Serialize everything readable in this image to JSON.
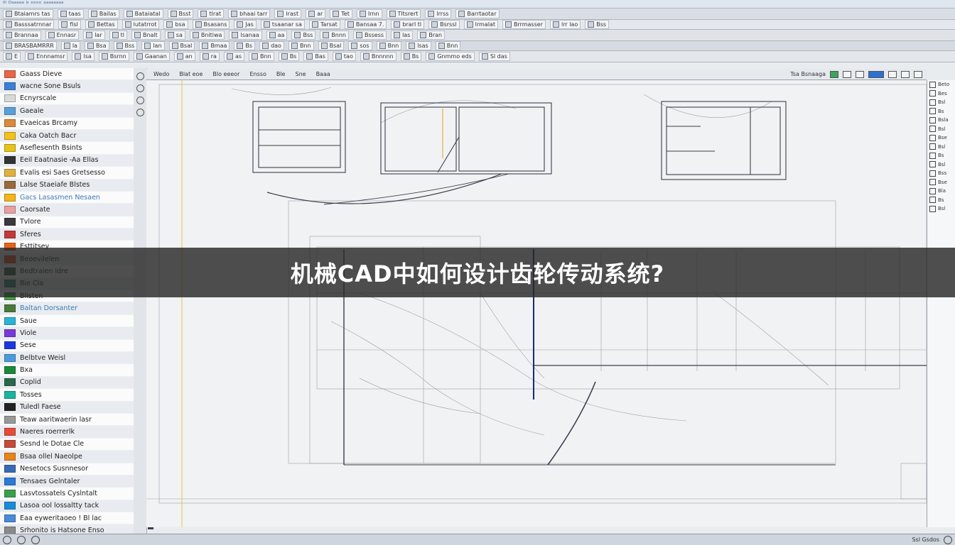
{
  "titlebar": {
    "text": "ᴵᴵᴵ ᴰᵃᵃᵃᵃᵃ ᵇ ᵉᵉᵉᵉ ᵃᵃᵃᵃᵃᵃᵃᵃ"
  },
  "toolbar_rows": [
    {
      "items": [
        "Btaiamrs tas",
        "taas",
        "Bailas",
        "Bataiatal",
        "Bsst",
        "tlrat",
        "bhaai tarr",
        "lrast",
        "ar",
        "Tet",
        "Irnn",
        "Tltsrert",
        "lrrss",
        "Barrtaotar"
      ]
    },
    {
      "items": [
        "Basssatrnnar",
        "fisl",
        "Bettas",
        "lutatrrot",
        "bsa",
        "Bsasans",
        "Jas",
        "tsaanar sa",
        "Tarsat",
        "Bansaa 7.",
        "brarl tl",
        "Bsrssl",
        "lrmalat",
        "Brrmasser",
        "lrr lao",
        "Bss"
      ]
    },
    {
      "items": [
        "Brannaa",
        "Ennasr",
        "lar",
        "tl",
        "Bnalt",
        "sa",
        "Bnitiwa",
        "lsanaa",
        "aa",
        "Bss",
        "Bnnn",
        "Bssess",
        "las",
        "Bran"
      ]
    },
    {
      "items": [
        "BRASBAMRRR",
        "la",
        "Bsa",
        "Bss",
        "lan",
        "Bsal",
        "Bmaa",
        "Bs",
        "dao",
        "Bnn",
        "Bsal",
        "sos",
        "Bnn",
        "lsas",
        "Bnn"
      ]
    },
    {
      "items": [
        "E",
        "Ennnamsr",
        "lsa",
        "Bsrnn",
        "Gaanan",
        "an",
        "ra",
        "as",
        "Bnn",
        "Bs",
        "Bas",
        "tao",
        "Bnnnnn",
        "Bs",
        "Gnmmo eds",
        "Sl das"
      ]
    }
  ],
  "left_panel": {
    "items": [
      {
        "label": "Gaass Dieve",
        "color": "#e8664a"
      },
      {
        "label": "wacne Sone Bsuls",
        "color": "#3d7fd4"
      },
      {
        "label": "Ecnyrscale",
        "color": "#d9d9d9"
      },
      {
        "label": "Gaeale",
        "color": "#5aa0d8"
      },
      {
        "label": "Evaeicas Brcamy",
        "color": "#d98a3a"
      },
      {
        "label": "Caka Oatch Bacr",
        "color": "#f2c21a"
      },
      {
        "label": "Aseflesenth Bsints",
        "color": "#e6c21a"
      },
      {
        "label": "Eeil Eaatnasie -Aa Ellas",
        "color": "#333333"
      },
      {
        "label": "Evalis esi Saes Gretsesso",
        "color": "#e0b040"
      },
      {
        "label": "Lalse Staeiafe Blstes",
        "color": "#9a6a3a"
      },
      {
        "label": "Gacs Lasasmen Nesaen",
        "color": "#f2b51a",
        "selected": true
      },
      {
        "label": "Caorsate",
        "color": "#e8a0a0"
      },
      {
        "label": "Tvlore",
        "color": "#3a3a3a"
      },
      {
        "label": "Sferes",
        "color": "#c03a3a"
      },
      {
        "label": "Esttitsey",
        "color": "#e8641a"
      },
      {
        "label": "Beoevilelen",
        "color": "#e84a1a"
      },
      {
        "label": "Bedtralen Idre",
        "color": "#3a5a3a"
      },
      {
        "label": "Bie Cla",
        "color": "#2a8a6a"
      },
      {
        "label": "Blisten",
        "color": "#4aa04a"
      },
      {
        "label": "Baltan Dorsanter",
        "color": "#4a7a3a",
        "selected": true
      },
      {
        "label": "Saue",
        "color": "#29b4d8"
      },
      {
        "label": "Viole",
        "color": "#7a3ad8"
      },
      {
        "label": "Sese",
        "color": "#1a3ae0"
      },
      {
        "label": "Belbtve Weisl",
        "color": "#4a9ae0"
      },
      {
        "label": "Bxa",
        "color": "#1a8a3a"
      },
      {
        "label": "Coplid",
        "color": "#2a6a4a"
      },
      {
        "label": "Tosses",
        "color": "#1ab4a0"
      },
      {
        "label": "Tuledl Faese",
        "color": "#222222"
      },
      {
        "label": "Teaw aaritwaerin lasr",
        "color": "#999999"
      },
      {
        "label": "Naeres roerrerlk",
        "color": "#e84a3a"
      },
      {
        "label": "Sesnd le Dotae Cle",
        "color": "#c84a3a"
      },
      {
        "label": "Bsaa ollel Naeolpe",
        "color": "#e8841a"
      },
      {
        "label": "Nesetocs Susnnesor",
        "color": "#3a6ab4"
      },
      {
        "label": "Tensaes Gelntaler",
        "color": "#2a7ad8"
      },
      {
        "label": "Lasvtossatels Cyslntalt",
        "color": "#3aa04a"
      },
      {
        "label": "Lasoa ool lossaltty tack",
        "color": "#1a8ad8"
      },
      {
        "label": "Eaa eyweritaoeo ! Bl lac",
        "color": "#4a8ad8"
      },
      {
        "label": "Srhonito is Hatsone Enso",
        "color": "#8a8a8a"
      },
      {
        "label": "Semeamueicn Nailsmesel",
        "color": "#e8b41a"
      },
      {
        "label": "Ssvoteo . Oee Clonsl.1",
        "color": "#e8641a"
      }
    ]
  },
  "viewport_toolbar": {
    "items": [
      "Wedo",
      "Blat eoe",
      "Blo eeeor",
      "Ensso",
      "Ble",
      "Sne",
      "Baaa"
    ],
    "right_label": "Tsa Bsnaaga"
  },
  "right_panel": {
    "items": [
      "Beto",
      "Bes",
      "Bsl",
      "Bs",
      "Bsla",
      "Bsl",
      "Bse",
      "Bsl",
      "Bs",
      "Bsl",
      "Bss",
      "Bse",
      "Bla",
      "Bs",
      "Bsl"
    ]
  },
  "statusbar": {
    "text": "Ssl Gsdos"
  },
  "overlay": {
    "title": "机械CAD中如何设计齿轮传动系统?"
  },
  "colors": {
    "accent_yellow": "#f2c21a",
    "title_text": "#ffffff",
    "overlay_bg": "#282828"
  }
}
